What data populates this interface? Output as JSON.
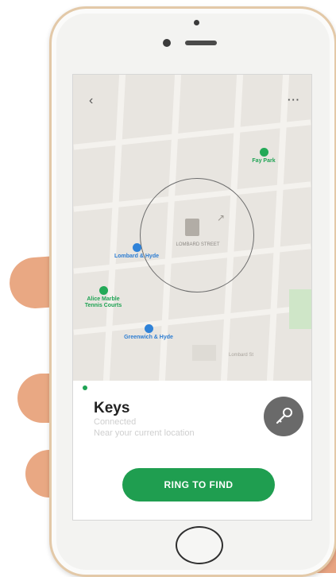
{
  "map": {
    "places": [
      {
        "name": "Fay Park",
        "color": "#1fa354"
      },
      {
        "name": "Alice Marble Tennis Courts",
        "color": "#1fa354"
      },
      {
        "name": "Lombard & Hyde",
        "color": "#2d7dd2"
      },
      {
        "name": "Greenwich & Hyde",
        "color": "#2d7dd2"
      }
    ],
    "center_label": "LOMBARD STREET",
    "street_label": "Lombard St"
  },
  "nav": {
    "back_icon": "chevron-left-icon",
    "more_label": "···"
  },
  "tile": {
    "title": "Keys",
    "subtitle_line1": "Connected",
    "subtitle_line2": "Near your current location",
    "status_color": "#1fa354",
    "icon": "key-icon"
  },
  "action": {
    "ring_label": "RING TO FIND",
    "accent": "#1f9e50"
  }
}
